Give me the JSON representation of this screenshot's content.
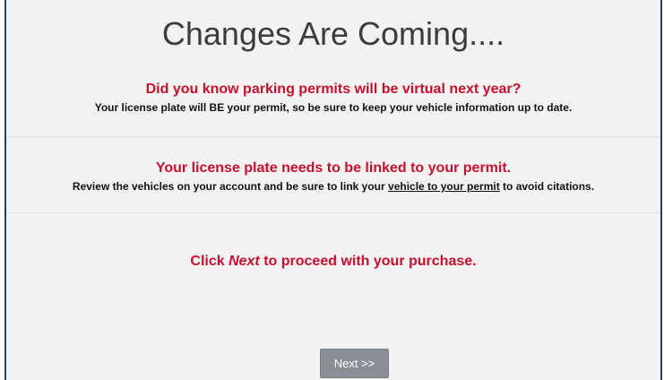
{
  "page": {
    "title": "Changes Are Coming...."
  },
  "notice1": {
    "heading": "Did you know parking permits will be virtual next year?",
    "body": "Your license plate will BE your permit, so be sure to keep your vehicle information up to date."
  },
  "notice2": {
    "heading": "Your license plate needs to be linked to your permit.",
    "body_before": "Review the vehicles on your account and be sure to link your ",
    "body_link": "vehicle to your permit",
    "body_after": " to avoid citations."
  },
  "cta": {
    "prefix": "Click ",
    "emphasis": "Next",
    "suffix": " to proceed with your purchase."
  },
  "actions": {
    "next_label": "Next >>"
  },
  "colors": {
    "accent_red": "#c8102e",
    "panel_bg": "#f2f2f2",
    "border_navy": "#1f3f6e",
    "button_gray": "#8a8f95"
  }
}
